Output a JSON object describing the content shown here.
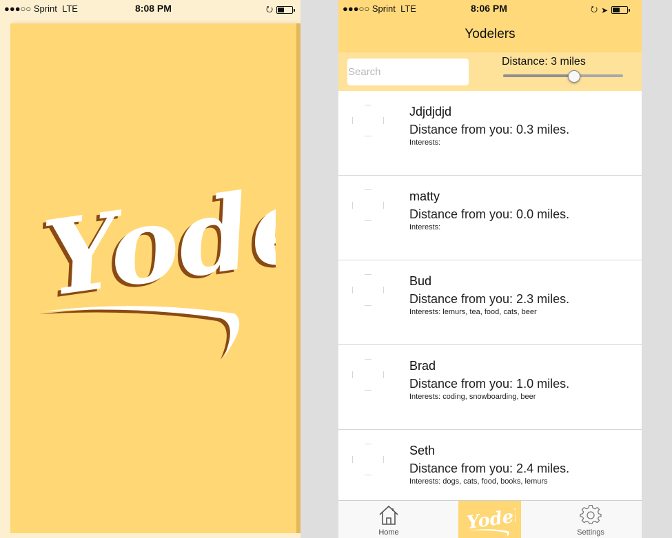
{
  "left_screen": {
    "status_bar": {
      "carrier": "●●●○○ Sprint",
      "network": "LTE",
      "time": "8:08 PM"
    },
    "logo_text": "Yodel"
  },
  "right_screen": {
    "status_bar": {
      "carrier": "●●●○○ Sprint",
      "network": "LTE",
      "time": "8:06 PM"
    },
    "nav_title": "Yodelers",
    "search": {
      "placeholder": "Search",
      "value": ""
    },
    "distance_filter": {
      "label": "Distance: 3 miles",
      "value": 3,
      "level": 0.59
    },
    "users": [
      {
        "name": "Jdjdjdjd",
        "distance": "Distance from you: 0.3 miles.",
        "interests": "Interests:"
      },
      {
        "name": "matty",
        "distance": "Distance from you: 0.0 miles.",
        "interests": "Interests:"
      },
      {
        "name": "Bud",
        "distance": "Distance from you: 2.3 miles.",
        "interests": "Interests: lemurs, tea, food, cats, beer"
      },
      {
        "name": "Brad",
        "distance": "Distance from you: 1.0 miles.",
        "interests": "Interests: coding, snowboarding, beer"
      },
      {
        "name": "Seth",
        "distance": "Distance from you: 2.4 miles.",
        "interests": "Interests: dogs, cats, food, books, lemurs"
      }
    ],
    "tab_bar": {
      "home_label": "Home",
      "center_logo_text": "Yodel",
      "settings_label": "Settings"
    }
  },
  "colors": {
    "brand_yellow": "#ffd775",
    "nav_yellow": "#ffd97a",
    "filter_yellow": "#ffe29a",
    "logo_white": "#ffffff",
    "logo_shadow": "#8a4a12"
  }
}
